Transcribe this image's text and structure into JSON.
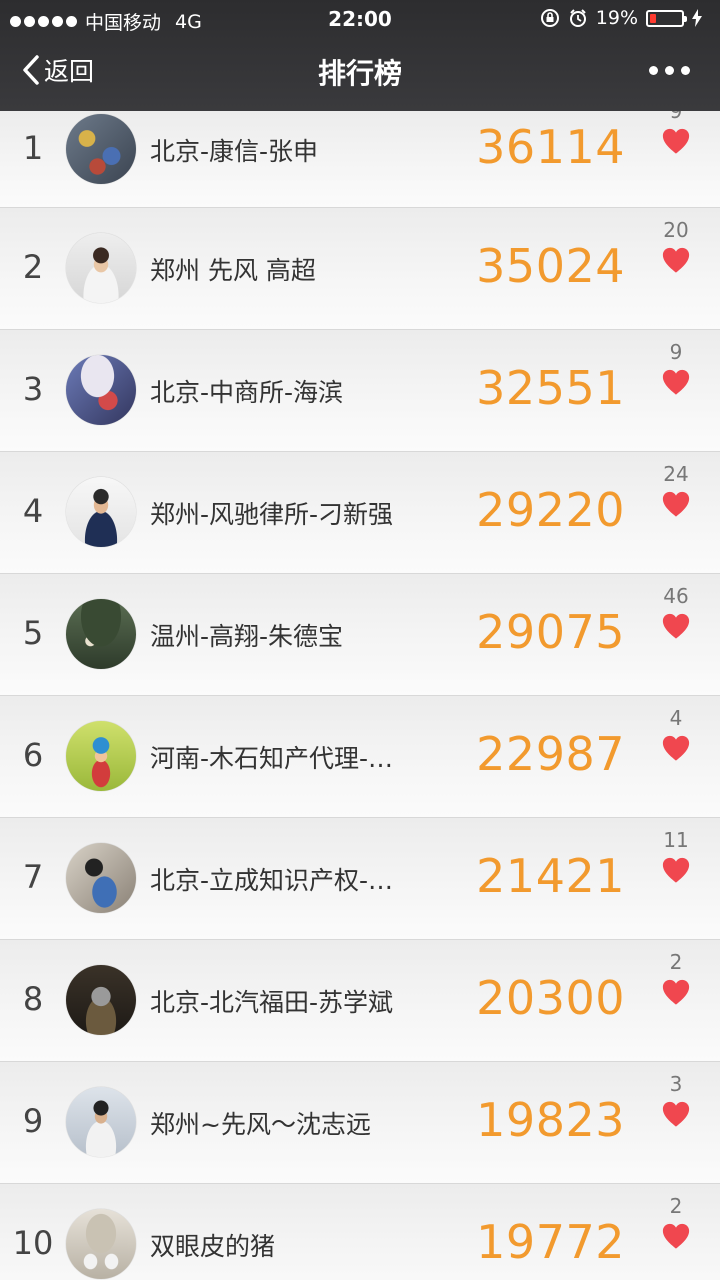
{
  "status_bar": {
    "carrier": "中国移动",
    "network": "4G",
    "time": "22:00",
    "battery": "19%",
    "battery_level": 0.19
  },
  "nav": {
    "back_label": "返回",
    "title": "排行榜",
    "more_icon": "more-dots-icon"
  },
  "colors": {
    "score": "#f29a2e",
    "heart": "#f0474f",
    "header_bg": "#333335"
  },
  "rankings": [
    {
      "rank": "1",
      "name": "北京-康信-张申",
      "score": "36114",
      "likes": "9"
    },
    {
      "rank": "2",
      "name": "郑州 先风 高超",
      "score": "35024",
      "likes": "20"
    },
    {
      "rank": "3",
      "name": "北京-中商所-海滨",
      "score": "32551",
      "likes": "9"
    },
    {
      "rank": "4",
      "name": "郑州-风驰律所-刁新强",
      "score": "29220",
      "likes": "24"
    },
    {
      "rank": "5",
      "name": "温州-高翔-朱德宝",
      "score": "29075",
      "likes": "46"
    },
    {
      "rank": "6",
      "name": "河南-木石知产代理-…",
      "score": "22987",
      "likes": "4"
    },
    {
      "rank": "7",
      "name": "北京-立成知识产权-…",
      "score": "21421",
      "likes": "11"
    },
    {
      "rank": "8",
      "name": "北京-北汽福田-苏学斌",
      "score": "20300",
      "likes": "2"
    },
    {
      "rank": "9",
      "name": "郑州~先风～沈志远",
      "score": "19823",
      "likes": "3"
    },
    {
      "rank": "10",
      "name": "双眼皮的猪",
      "score": "19772",
      "likes": "2"
    }
  ]
}
